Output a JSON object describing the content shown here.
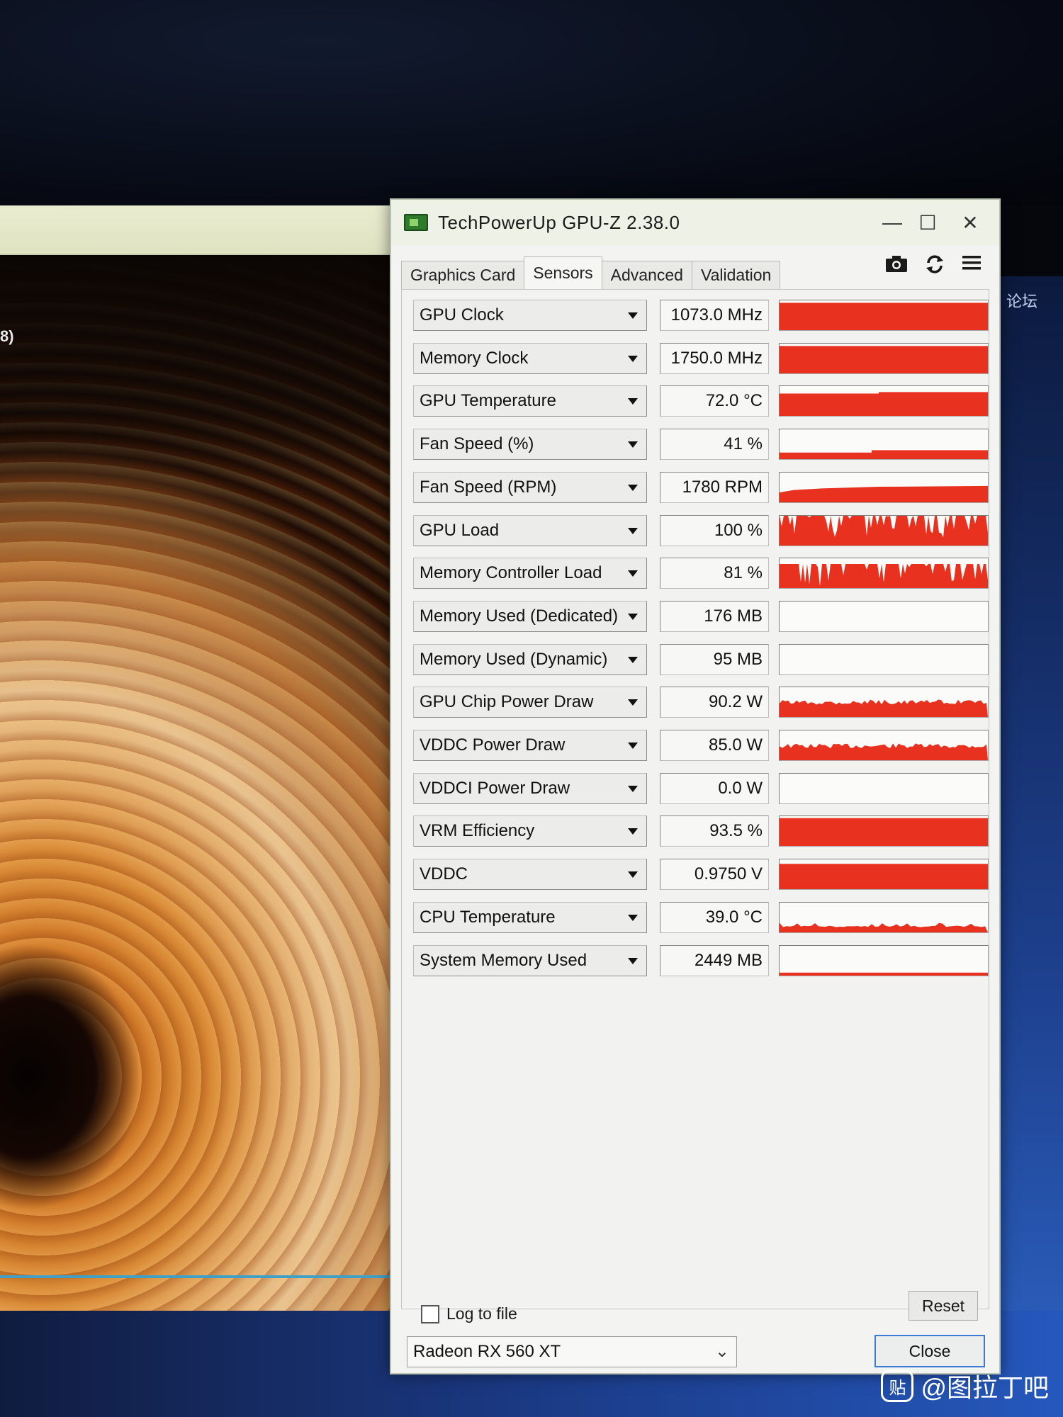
{
  "window": {
    "title": "TechPowerUp GPU-Z 2.38.0",
    "minimize_glyph": "—",
    "maximize_glyph": "☐",
    "close_glyph": "✕"
  },
  "tabs": [
    {
      "label": "Graphics Card",
      "active": false
    },
    {
      "label": "Sensors",
      "active": true
    },
    {
      "label": "Advanced",
      "active": false
    },
    {
      "label": "Validation",
      "active": false
    }
  ],
  "toolbar": {
    "icons": [
      "camera-icon",
      "refresh-icon",
      "menu-icon"
    ]
  },
  "sensors": [
    {
      "label": "GPU Clock",
      "value": "1073.0 MHz",
      "graph": "full",
      "level": 0.92
    },
    {
      "label": "Memory Clock",
      "value": "1750.0 MHz",
      "graph": "full",
      "level": 0.92
    },
    {
      "label": "GPU Temperature",
      "value": "72.0 °C",
      "graph": "step",
      "level": 0.8
    },
    {
      "label": "Fan Speed (%)",
      "value": "41 %",
      "graph": "low",
      "level": 0.3
    },
    {
      "label": "Fan Speed (RPM)",
      "value": "1780 RPM",
      "graph": "ramp",
      "level": 0.55
    },
    {
      "label": "GPU Load",
      "value": "100 %",
      "graph": "spiky",
      "level": 1.0
    },
    {
      "label": "Memory Controller Load",
      "value": "81 %",
      "graph": "spiky",
      "level": 0.81
    },
    {
      "label": "Memory Used (Dedicated)",
      "value": "176 MB",
      "graph": "empty",
      "level": 0.0
    },
    {
      "label": "Memory Used (Dynamic)",
      "value": "95 MB",
      "graph": "empty",
      "level": 0.0
    },
    {
      "label": "GPU Chip Power Draw",
      "value": "90.2 W",
      "graph": "noisy",
      "level": 0.5
    },
    {
      "label": "VDDC Power Draw",
      "value": "85.0 W",
      "graph": "noisy",
      "level": 0.48
    },
    {
      "label": "VDDCI Power Draw",
      "value": "0.0 W",
      "graph": "empty",
      "level": 0.0
    },
    {
      "label": "VRM Efficiency",
      "value": "93.5 %",
      "graph": "full",
      "level": 0.935
    },
    {
      "label": "VDDC",
      "value": "0.9750 V",
      "graph": "full",
      "level": 0.85
    },
    {
      "label": "CPU Temperature",
      "value": "39.0 °C",
      "graph": "thin",
      "level": 0.2
    },
    {
      "label": "System Memory Used",
      "value": "2449 MB",
      "graph": "line",
      "level": 0.1
    }
  ],
  "footer": {
    "log_to_file_label": "Log to file",
    "log_to_file_checked": false,
    "reset_label": "Reset",
    "selected_gpu": "Radeon RX 560 XT",
    "close_label": "Close"
  },
  "background": {
    "left_fragment_text": "8)",
    "right_fragment_text": "论坛"
  },
  "watermark": {
    "logo_text": "贴",
    "text": "@图拉丁吧"
  },
  "colors": {
    "graph_fill": "#e8311f",
    "window_bg": "#f3f3f1",
    "titlebar_bg": "#eef1e5",
    "close_border": "#3a7bd5"
  }
}
